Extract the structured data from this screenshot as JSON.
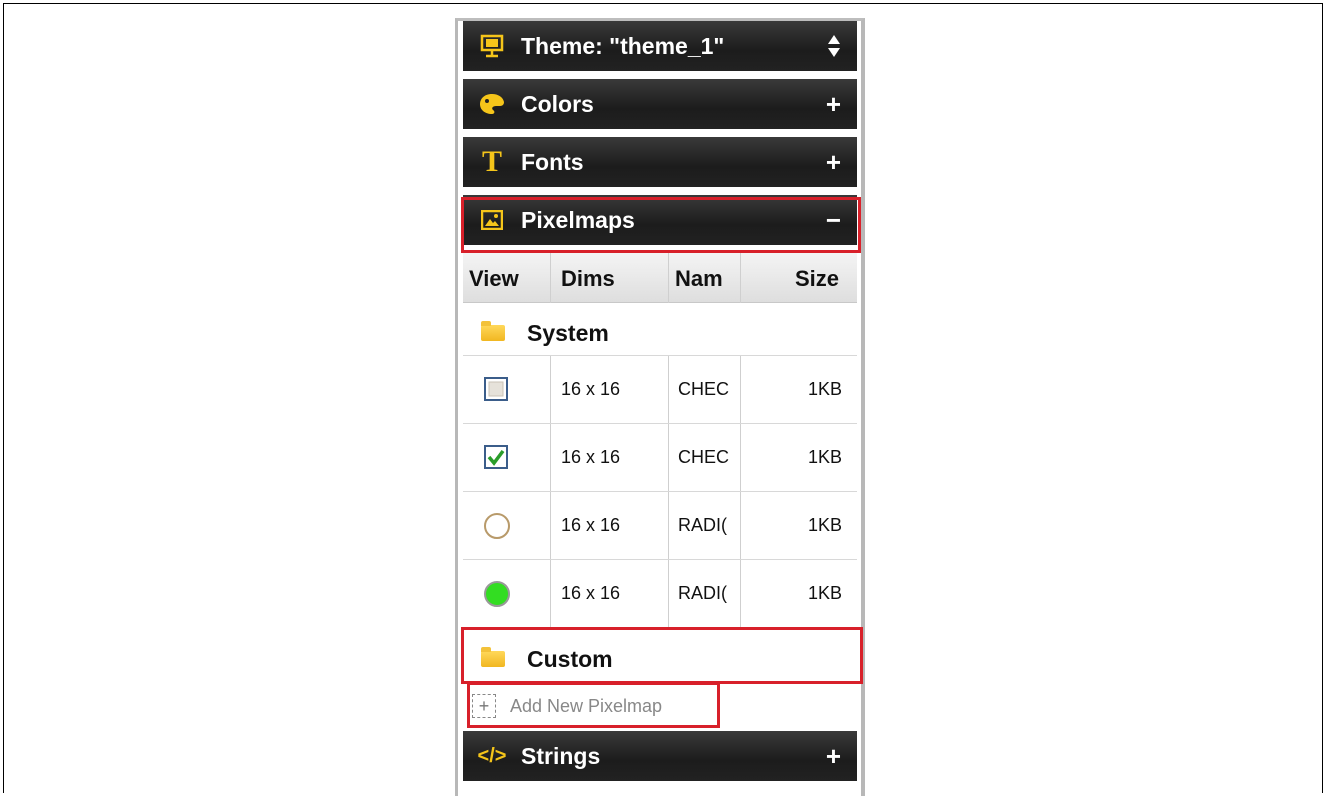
{
  "theme_header": {
    "label": "Theme: \"theme_1\"",
    "icon": "presentation-icon",
    "control_icon": "up-down-arrows-icon"
  },
  "sections": {
    "colors": {
      "label": "Colors",
      "icon": "palette-icon",
      "control": "+"
    },
    "fonts": {
      "label": "Fonts",
      "icon": "font-t-icon",
      "control": "+"
    },
    "pixelmaps": {
      "label": "Pixelmaps",
      "icon": "image-icon",
      "control": "−"
    },
    "strings": {
      "label": "Strings",
      "icon": "code-tag-icon",
      "icon_text": "</>",
      "control": "+"
    }
  },
  "table": {
    "columns": [
      "View",
      "Dims",
      "Nam",
      "Size"
    ],
    "groups": {
      "system": {
        "label": "System",
        "icon": "folder-icon"
      },
      "custom": {
        "label": "Custom",
        "icon": "folder-icon"
      }
    },
    "rows": [
      {
        "view_icon": "checkbox-unchecked-icon",
        "dims": "16 x 16",
        "name": "CHEC",
        "size": "1KB"
      },
      {
        "view_icon": "checkbox-checked-icon",
        "dims": "16 x 16",
        "name": "CHEC",
        "size": "1KB"
      },
      {
        "view_icon": "radio-off-icon",
        "dims": "16 x 16",
        "name": "RADI(",
        "size": "1KB"
      },
      {
        "view_icon": "radio-on-icon",
        "dims": "16 x 16",
        "name": "RADI(",
        "size": "1KB"
      }
    ]
  },
  "add_new": {
    "label": "Add New Pixelmap",
    "icon": "add-dashed-icon",
    "icon_text": "+"
  },
  "colors": {
    "header_bg": "#222222",
    "accent_yellow": "#f5c51a",
    "highlight_red": "#d8202a",
    "radio_green": "#33dd22",
    "check_green": "#2a9d2a"
  }
}
